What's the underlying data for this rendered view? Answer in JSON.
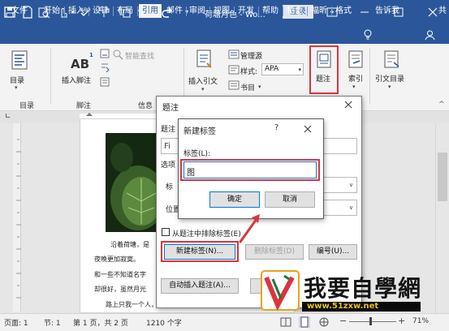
{
  "titlebar": {
    "doc_title": "荷塘月色 - Wo...",
    "login_label": "登录"
  },
  "menu": {
    "tabs": [
      "文件",
      "开始",
      "插入",
      "设计",
      "布局",
      "引用",
      "邮件",
      "审阅",
      "视图",
      "开发",
      "帮助",
      "特色",
      "福昕",
      "格式"
    ],
    "active": "引用",
    "tell_me": "告诉我",
    "share_label": "共"
  },
  "ribbon": {
    "toc_label": "目录",
    "insert_footnote_label": "插入脚注",
    "smart_lookup_label": "智能查找",
    "insert_citation_label": "插入引文",
    "manage_sources_label": "管理源",
    "style_label": "样式:",
    "style_value": "APA",
    "bibliography_label": "书目",
    "caption_label": "题注",
    "index_label": "索引",
    "toa_label": "引文目录",
    "groups": {
      "toc": "目录",
      "footnotes": "脚注",
      "info": "信息"
    },
    "footnote_superscript": "1"
  },
  "caption_dialog": {
    "title": "题注",
    "caption_label": "题注",
    "caption_value": "Fi",
    "options_label": "选项",
    "label_label": "标",
    "position_label": "位置",
    "exclude_label": "从题注中排除标签(E)",
    "new_label_button": "新建标签(N)...",
    "delete_label_button": "删除标签(D)",
    "numbering_button": "编号(U)...",
    "autocaption_button": "自动插入题注(A)..."
  },
  "new_label_dialog": {
    "title": "新建标签",
    "help": "?",
    "label_prompt": "标签(L):",
    "label_value": "图",
    "ok_button": "确定",
    "cancel_button": "取消"
  },
  "document": {
    "lines": [
      "沿着荷塘，是",
      "夜晚更加寂寞。",
      "和一些不知道名字",
      "却很好，虽然月光",
      "路上只我一个人，背着手踱着，这一片天地"
    ]
  },
  "statusbar": {
    "page": "页面: 1",
    "section": "节: 1",
    "page_of": "第 1 页，共 2 页",
    "words": "1210 个字",
    "zoom": "71%"
  },
  "watermark": {
    "text": "我要自學網",
    "url": "www.51zxw.net"
  },
  "colors": {
    "accent": "#2b579a",
    "highlight": "#d9363e",
    "ok_border": "#0078d7"
  }
}
